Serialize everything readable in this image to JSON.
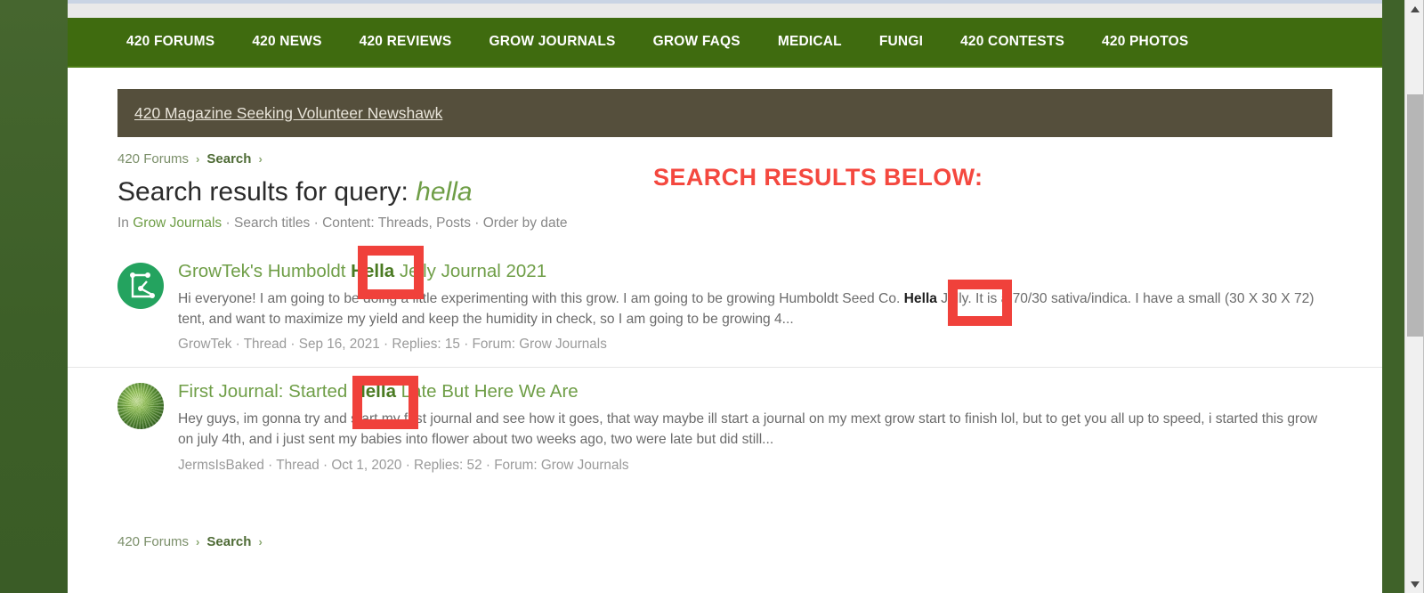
{
  "nav": {
    "items": [
      {
        "label": "420 FORUMS"
      },
      {
        "label": "420 NEWS"
      },
      {
        "label": "420 REVIEWS"
      },
      {
        "label": "GROW JOURNALS"
      },
      {
        "label": "GROW FAQS"
      },
      {
        "label": "MEDICAL"
      },
      {
        "label": "FUNGI"
      },
      {
        "label": "420 CONTESTS"
      },
      {
        "label": "420 PHOTOS"
      }
    ]
  },
  "notice": {
    "link_text": "420 Magazine Seeking Volunteer Newshawk"
  },
  "breadcrumb": {
    "root": "420 Forums",
    "current": "Search",
    "separator": "›"
  },
  "heading": {
    "prefix": "Search results for query:",
    "query": "hella"
  },
  "subline": {
    "in_label": "In",
    "node": "Grow Journals",
    "sep": "·",
    "search_titles": "Search titles",
    "content": "Content: Threads, Posts",
    "order": "Order by date"
  },
  "annotation": {
    "label": "SEARCH RESULTS BELOW:",
    "color": "#f4483f",
    "box_color": "#f0413b"
  },
  "results": [
    {
      "avatar": "node-graph-icon",
      "title_before": "GrowTek's Humboldt ",
      "title_highlight": "Hella",
      "title_after": " Jelly Journal 2021",
      "snippet_before": "Hi everyone! I am going to be doing a little experimenting with this grow. I am going to be growing Humboldt Seed Co. ",
      "snippet_highlight": "Hella",
      "snippet_after": " Jelly. It is a 70/30 sativa/indica. I have a small (30 X 30 X 72) tent, and want to maximize my yield and keep the humidity in check, so I am going to be growing 4...",
      "author": "GrowTek",
      "type": "Thread",
      "date": "Sep 16, 2021",
      "replies": "Replies: 15",
      "forum": "Forum: Grow Journals"
    },
    {
      "avatar": "cannabis-bud-photo",
      "title_before": "First Journal: Started ",
      "title_highlight": "Hella",
      "title_after": " Late But Here We Are",
      "snippet_before": "Hey guys, im gonna try and start my first journal and see how it goes, that way maybe ill start a journal on my mext grow start to finish lol, but to get you all up to speed, i started this grow on july 4th, and i just sent my babies into flower about two weeks ago, two were late but did still...",
      "snippet_highlight": "",
      "snippet_after": "",
      "author": "JermsIsBaked",
      "type": "Thread",
      "date": "Oct 1, 2020",
      "replies": "Replies: 52",
      "forum": "Forum: Grow Journals"
    }
  ],
  "meta_sep": "·",
  "scrollbar": {
    "up_icon": "chevron-up-icon",
    "down_icon": "chevron-down-icon"
  }
}
